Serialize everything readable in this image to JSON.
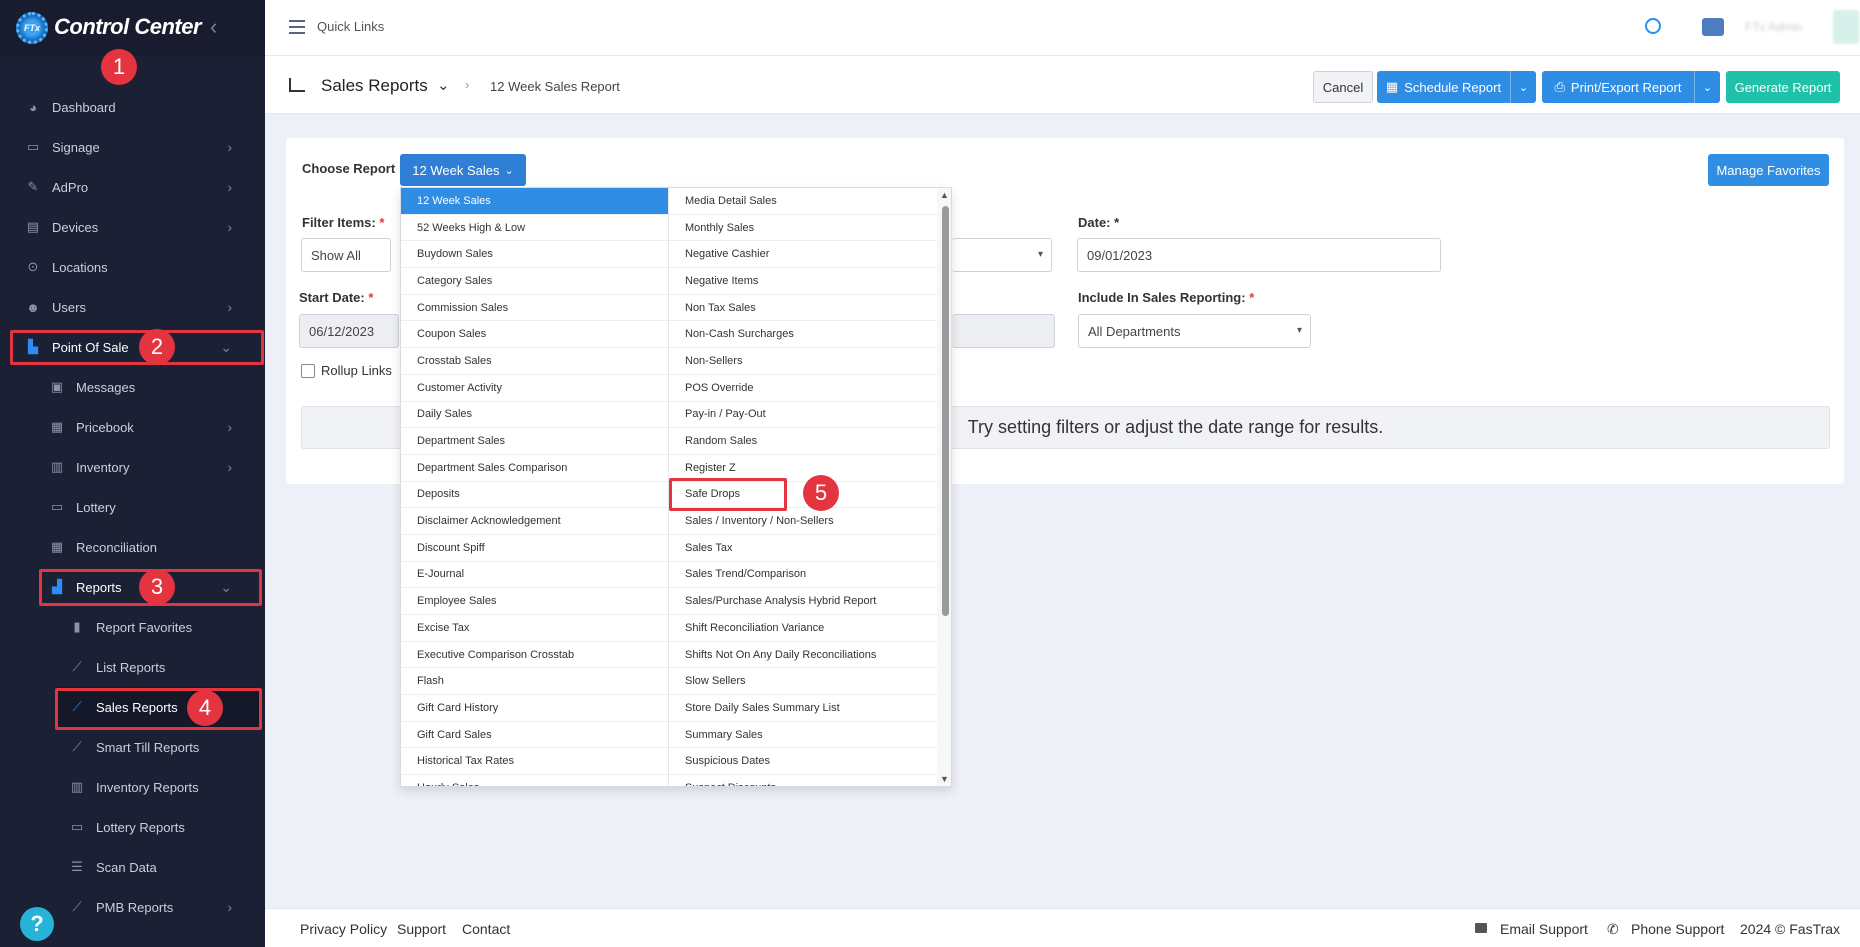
{
  "app": {
    "title": "Control Center",
    "logo_text": "FTx"
  },
  "sidebar": {
    "items": [
      {
        "label": "Dashboard",
        "icon": "palette-icon"
      },
      {
        "label": "Signage",
        "icon": "monitor-icon"
      },
      {
        "label": "AdPro",
        "icon": "brush-icon"
      },
      {
        "label": "Devices",
        "icon": "cash-register-icon"
      },
      {
        "label": "Locations",
        "icon": "location-pin-icon"
      },
      {
        "label": "Users",
        "icon": "users-icon"
      },
      {
        "label": "Point Of Sale",
        "icon": "cart-icon"
      },
      {
        "label": "Messages",
        "icon": "inbox-icon"
      },
      {
        "label": "Pricebook",
        "icon": "calculator-icon"
      },
      {
        "label": "Inventory",
        "icon": "shelves-icon"
      },
      {
        "label": "Lottery",
        "icon": "ticket-icon"
      },
      {
        "label": "Reconciliation",
        "icon": "grid-icon"
      },
      {
        "label": "Reports",
        "icon": "bar-chart-icon"
      },
      {
        "label": "Report Favorites",
        "icon": "bookmark-icon"
      },
      {
        "label": "List Reports",
        "icon": "line-chart-icon"
      },
      {
        "label": "Sales Reports",
        "icon": "line-chart-icon"
      },
      {
        "label": "Smart Till Reports",
        "icon": "line-chart-icon"
      },
      {
        "label": "Inventory Reports",
        "icon": "shelves-icon"
      },
      {
        "label": "Lottery Reports",
        "icon": "ticket-icon"
      },
      {
        "label": "Scan Data",
        "icon": "list-icon"
      },
      {
        "label": "PMB Reports",
        "icon": "line-chart-icon"
      }
    ]
  },
  "annotations": [
    "1",
    "2",
    "3",
    "4",
    "5"
  ],
  "topbar": {
    "quick_links": "Quick Links",
    "user": "FTx Admin"
  },
  "header": {
    "title": "Sales Reports",
    "breadcrumb": "12 Week Sales Report",
    "buttons": {
      "cancel": "Cancel",
      "schedule": "Schedule Report",
      "print": "Print/Export Report",
      "generate": "Generate Report"
    }
  },
  "form": {
    "choose_report_label": "Choose Report",
    "choose_report_value": "12 Week Sales",
    "manage_favorites": "Manage Favorites",
    "filter_items_label": "Filter Items:",
    "filter_items_value": "Show All",
    "date_label": "Date:",
    "date_value": "09/01/2023",
    "start_date_label": "Start Date:",
    "start_date_value": "06/12/2023",
    "include_label": "Include In Sales Reporting:",
    "include_value": "All Departments",
    "rollup_label": "Rollup Links",
    "required_mark": "*",
    "no_results": "Try setting filters or adjust the date range for results."
  },
  "dropdown": {
    "left": [
      "12 Week Sales",
      "52 Weeks High & Low",
      "Buydown Sales",
      "Category Sales",
      "Commission Sales",
      "Coupon Sales",
      "Crosstab Sales",
      "Customer Activity",
      "Daily Sales",
      "Department Sales",
      "Department Sales Comparison",
      "Deposits",
      "Disclaimer Acknowledgement",
      "Discount Spiff",
      "E-Journal",
      "Employee Sales",
      "Excise Tax",
      "Executive Comparison Crosstab",
      "Flash",
      "Gift Card History",
      "Gift Card Sales",
      "Historical Tax Rates",
      "Hourly Sales"
    ],
    "right": [
      "Media Detail Sales",
      "Monthly Sales",
      "Negative Cashier",
      "Negative Items",
      "Non Tax Sales",
      "Non-Cash Surcharges",
      "Non-Sellers",
      "POS Override",
      "Pay-in / Pay-Out",
      "Random Sales",
      "Register Z",
      "Safe Drops",
      "Sales / Inventory / Non-Sellers",
      "Sales Tax",
      "Sales Trend/Comparison",
      "Sales/Purchase Analysis Hybrid Report",
      "Shift Reconciliation Variance",
      "Shifts Not On Any Daily Reconciliations",
      "Slow Sellers",
      "Store Daily Sales Summary List",
      "Summary Sales",
      "Suspicious Dates",
      "Suspect Discounts"
    ],
    "selected": "12 Week Sales"
  },
  "footer": {
    "privacy": "Privacy Policy",
    "support": "Support",
    "contact": "Contact",
    "email_support": "Email Support",
    "phone_support": "Phone Support",
    "copyright": "2024 © FasTrax"
  }
}
